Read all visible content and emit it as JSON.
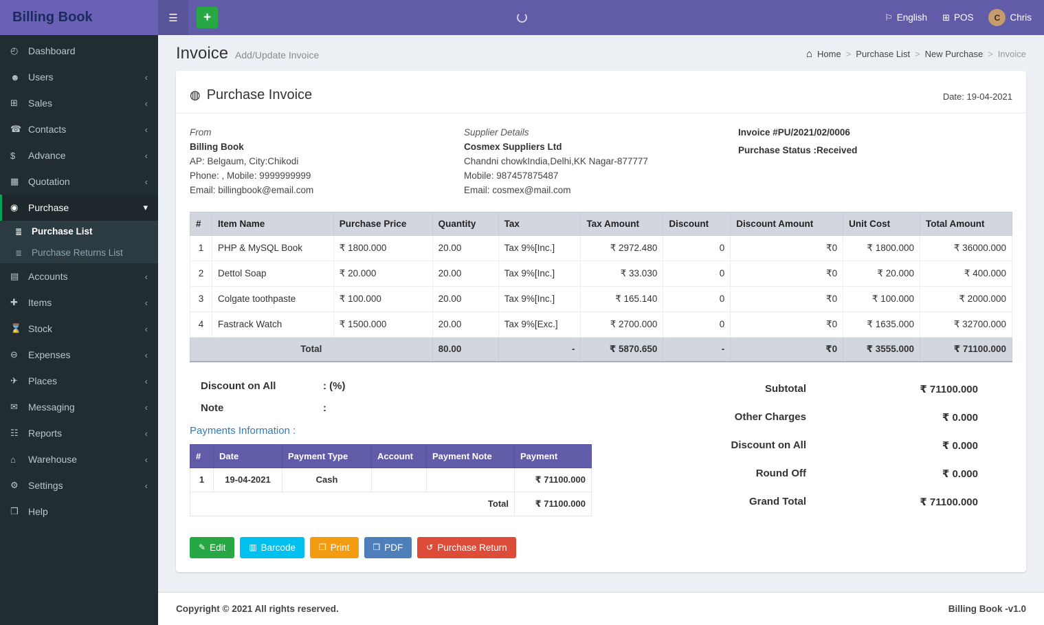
{
  "brand": {
    "logo": "Billing Book"
  },
  "colors": {
    "navbar_purple": "#605ca8",
    "sidebar_dark": "#222d32",
    "active_accent_green": "#00a65a",
    "table_header_gray": "#d2d6de",
    "payments_header_purple": "#605ca8",
    "link_blue": "#337ab7"
  },
  "topbar": {
    "hamburger_icon": "☰",
    "add_icon": "+",
    "language": {
      "icon": "⚐",
      "label": "English"
    },
    "pos": {
      "icon": "⊞",
      "label": "POS"
    },
    "user": {
      "initial": "C",
      "name": "Chris"
    }
  },
  "sidebar": {
    "items": [
      {
        "id": "dashboard",
        "icon_name": "dashboard-icon",
        "icon": "◴",
        "label": "Dashboard",
        "chevron": ""
      },
      {
        "id": "users",
        "icon_name": "users-icon",
        "icon": "☻",
        "label": "Users",
        "chevron": "‹"
      },
      {
        "id": "sales",
        "icon_name": "cart-icon",
        "icon": "⊞",
        "label": "Sales",
        "chevron": "‹"
      },
      {
        "id": "contacts",
        "icon_name": "contacts-icon",
        "icon": "☎",
        "label": "Contacts",
        "chevron": "‹"
      },
      {
        "id": "advance",
        "icon_name": "dollar-icon",
        "icon": "$",
        "label": "Advance",
        "chevron": "‹"
      },
      {
        "id": "quotation",
        "icon_name": "quotation-icon",
        "icon": "▦",
        "label": "Quotation",
        "chevron": "‹"
      },
      {
        "id": "purchase",
        "icon_name": "purchase-icon",
        "icon": "◉",
        "label": "Purchase",
        "chevron": "▾",
        "active": true,
        "children": [
          {
            "id": "purchase-list",
            "icon_name": "list-icon",
            "icon": "≣",
            "label": "Purchase List",
            "active": true
          },
          {
            "id": "purchase-returns-list",
            "icon_name": "list-icon",
            "icon": "≣",
            "label": "Purchase Returns List"
          }
        ]
      },
      {
        "id": "accounts",
        "icon_name": "accounts-icon",
        "icon": "▤",
        "label": "Accounts",
        "chevron": "‹"
      },
      {
        "id": "items",
        "icon_name": "items-icon",
        "icon": "✚",
        "label": "Items",
        "chevron": "‹"
      },
      {
        "id": "stock",
        "icon_name": "stock-icon",
        "icon": "⌛",
        "label": "Stock",
        "chevron": "‹"
      },
      {
        "id": "expenses",
        "icon_name": "expenses-icon",
        "icon": "⊖",
        "label": "Expenses",
        "chevron": "‹"
      },
      {
        "id": "places",
        "icon_name": "places-icon",
        "icon": "✈",
        "label": "Places",
        "chevron": "‹"
      },
      {
        "id": "messaging",
        "icon_name": "messaging-icon",
        "icon": "✉",
        "label": "Messaging",
        "chevron": "‹"
      },
      {
        "id": "reports",
        "icon_name": "reports-icon",
        "icon": "☷",
        "label": "Reports",
        "chevron": "‹"
      },
      {
        "id": "warehouse",
        "icon_name": "warehouse-icon",
        "icon": "⌂",
        "label": "Warehouse",
        "chevron": "‹"
      },
      {
        "id": "settings",
        "icon_name": "settings-icon",
        "icon": "⚙",
        "label": "Settings",
        "chevron": "‹"
      },
      {
        "id": "help",
        "icon_name": "help-icon",
        "icon": "❒",
        "label": "Help",
        "chevron": ""
      }
    ]
  },
  "page": {
    "title": "Invoice",
    "subtitle": "Add/Update Invoice"
  },
  "breadcrumb": {
    "home_icon": "⌂",
    "separator": ">",
    "items": [
      {
        "label": "Home"
      },
      {
        "label": "Purchase List"
      },
      {
        "label": "New Purchase"
      },
      {
        "label": "Invoice",
        "current": true
      }
    ]
  },
  "card": {
    "title_icon": "◍",
    "title": "Purchase Invoice",
    "date": "Date: 19-04-2021",
    "from": {
      "heading": "From",
      "name": "Billing Book",
      "address": "AP: Belgaum, City:Chikodi",
      "phone": "Phone: , Mobile: 9999999999",
      "email": "Email: billingbook@email.com"
    },
    "supplier": {
      "heading": "Supplier Details",
      "name": "Cosmex Suppliers Ltd",
      "address": "Chandni chowkIndia,Delhi,KK Nagar-877777",
      "mobile": "Mobile: 987457875487",
      "email": "Email: cosmex@mail.com"
    },
    "meta": {
      "invoice_no": "Invoice #PU/2021/02/0006",
      "status": "Purchase Status :Received"
    },
    "discount_all": {
      "label": "Discount on All",
      "value": ": (%)"
    },
    "note": {
      "label": "Note",
      "value": ":"
    }
  },
  "items_table": {
    "headers": [
      "#",
      "Item Name",
      "Purchase Price",
      "Quantity",
      "Tax",
      "Tax Amount",
      "Discount",
      "Discount Amount",
      "Unit Cost",
      "Total Amount"
    ],
    "rows": [
      [
        "1",
        "PHP & MySQL Book",
        "₹ 1800.000",
        "20.00",
        "Tax 9%[Inc.]",
        "₹ 2972.480",
        "0",
        "₹0",
        "₹ 1800.000",
        "₹ 36000.000"
      ],
      [
        "2",
        "Dettol Soap",
        "₹ 20.000",
        "20.00",
        "Tax 9%[Inc.]",
        "₹ 33.030",
        "0",
        "₹0",
        "₹ 20.000",
        "₹ 400.000"
      ],
      [
        "3",
        "Colgate toothpaste",
        "₹ 100.000",
        "20.00",
        "Tax 9%[Inc.]",
        "₹ 165.140",
        "0",
        "₹0",
        "₹ 100.000",
        "₹ 2000.000"
      ],
      [
        "4",
        "Fastrack Watch",
        "₹ 1500.000",
        "20.00",
        "Tax 9%[Exc.]",
        "₹ 2700.000",
        "0",
        "₹0",
        "₹ 1635.000",
        "₹ 32700.000"
      ]
    ],
    "total_row": [
      "Total",
      "80.00",
      "-",
      "₹ 5870.650",
      "-",
      "₹0",
      "₹ 3555.000",
      "₹ 71100.000"
    ]
  },
  "payments": {
    "title": "Payments Information :",
    "headers": [
      "#",
      "Date",
      "Payment Type",
      "Account",
      "Payment Note",
      "Payment"
    ],
    "rows": [
      [
        "1",
        "19-04-2021",
        "Cash",
        "",
        "",
        "₹ 71100.000"
      ]
    ],
    "total_label": "Total",
    "total_value": "₹ 71100.000"
  },
  "summary": [
    {
      "label": "Subtotal",
      "value": "₹ 71100.000"
    },
    {
      "label": "Other Charges",
      "value": "₹ 0.000"
    },
    {
      "label": "Discount on All",
      "value": "₹ 0.000"
    },
    {
      "label": "Round Off",
      "value": "₹ 0.000"
    },
    {
      "label": "Grand Total",
      "value": "₹ 71100.000"
    }
  ],
  "actions": [
    {
      "name": "edit-button",
      "label": "Edit",
      "icon": "✎",
      "icon_name": "edit-icon",
      "color": "#28a745"
    },
    {
      "name": "barcode-button",
      "label": "Barcode",
      "icon": "▥",
      "icon_name": "barcode-icon",
      "color": "#00c0ef"
    },
    {
      "name": "print-button",
      "label": "Print",
      "icon": "❐",
      "icon_name": "printer-icon",
      "color": "#f39c12"
    },
    {
      "name": "pdf-button",
      "label": "PDF",
      "icon": "❒",
      "icon_name": "pdf-icon",
      "color": "#4f7fba"
    },
    {
      "name": "purchase-return-button",
      "label": "Purchase Return",
      "icon": "↺",
      "icon_name": "return-icon",
      "color": "#dd4b39"
    }
  ],
  "footer": {
    "copyright": "Copyright © 2021 All rights reserved.",
    "version": "Billing Book -v1.0"
  }
}
